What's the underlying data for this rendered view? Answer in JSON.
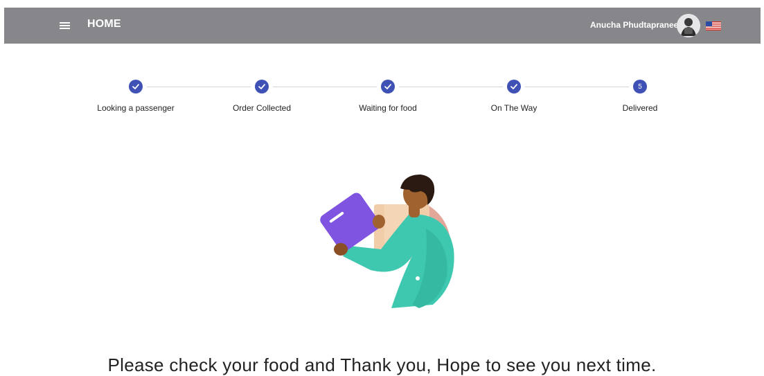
{
  "header": {
    "title": "HOME",
    "user_name": "Anucha Phudtapranee",
    "menu_icon": "menu-icon",
    "flag_icon": "us-flag-icon",
    "bar_color": "#86868b"
  },
  "stepper": {
    "accent_color": "#3f51b5",
    "steps": [
      {
        "label": "Looking a passenger",
        "state": "completed",
        "icon": "check-icon"
      },
      {
        "label": "Order Collected",
        "state": "completed",
        "icon": "check-icon"
      },
      {
        "label": "Waiting for food",
        "state": "completed",
        "icon": "check-icon"
      },
      {
        "label": "On The Way",
        "state": "completed",
        "icon": "check-icon"
      },
      {
        "label": "Delivered",
        "state": "active",
        "number": "5"
      }
    ]
  },
  "main": {
    "illustration": "delivery-person-illustration",
    "message": "Please check your food and Thank you, Hope to see you next time."
  }
}
